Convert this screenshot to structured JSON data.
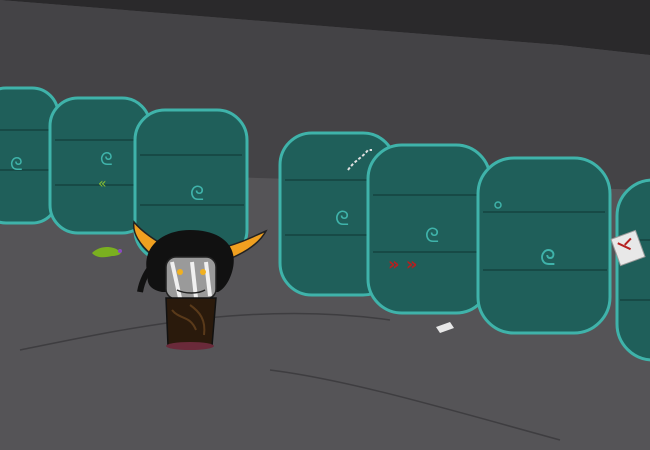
{
  "scene": {
    "description_type": "game-scene",
    "colors": {
      "ceiling": "#2a292b",
      "wall": "#474649",
      "floor": "#545356",
      "bale_fill": "#1f5f5a",
      "bale_stroke": "#3fb3aa",
      "horn": "#f0a020",
      "skin": "#9a9a9a",
      "robe": "#2a1a0c",
      "blood_red": "#b52020",
      "slime_green": "#7ab020",
      "paper": "#e8e8e8"
    },
    "objects": {
      "bales": [
        "hay-bale",
        "hay-bale",
        "hay-bale",
        "hay-bale",
        "hay-bale",
        "hay-bale",
        "hay-bale"
      ],
      "character": "troll-character",
      "items": [
        "green-slime-splat",
        "scrap-paper",
        "torn-note",
        "red-scribble",
        "white-scribble"
      ]
    }
  }
}
